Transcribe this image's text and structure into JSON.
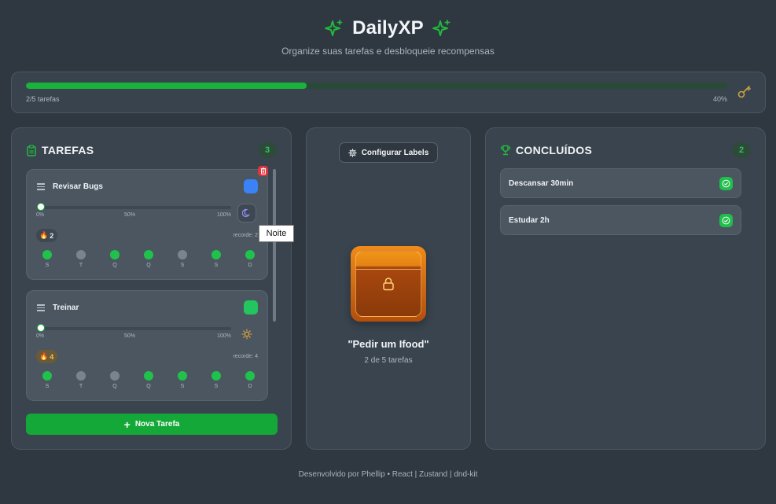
{
  "header": {
    "title": "DailyXP",
    "subtitle": "Organize suas tarefas e desbloqueie recompensas",
    "accent": "#22b83f"
  },
  "progress": {
    "label": "2/5 tarefas",
    "percent_label": "40%",
    "value": 0.4,
    "icon": "key-icon"
  },
  "tasks_column": {
    "title": "TAREFAS",
    "count": "3",
    "new_task_label": "Nova Tarefa",
    "tooltip": "Noite",
    "items": [
      {
        "name": "Revisar Bugs",
        "color": "#3b82f6",
        "slider_value": 0,
        "ticks": [
          "0%",
          "50%",
          "100%"
        ],
        "time_icon": "moon-icon",
        "streak": "2",
        "record": "recorde: 2",
        "days": [
          {
            "label": "S",
            "done": true
          },
          {
            "label": "T",
            "done": false
          },
          {
            "label": "Q",
            "done": true
          },
          {
            "label": "Q",
            "done": true
          },
          {
            "label": "S",
            "done": false
          },
          {
            "label": "S",
            "done": true
          },
          {
            "label": "D",
            "done": true
          }
        ]
      },
      {
        "name": "Treinar",
        "color": "#22c55e",
        "slider_value": 0,
        "ticks": [
          "0%",
          "50%",
          "100%"
        ],
        "time_icon": "sun-icon",
        "streak": "4",
        "record": "recorde: 4",
        "days": [
          {
            "label": "S",
            "done": true
          },
          {
            "label": "T",
            "done": false
          },
          {
            "label": "Q",
            "done": false
          },
          {
            "label": "Q",
            "done": true
          },
          {
            "label": "S",
            "done": true
          },
          {
            "label": "S",
            "done": true
          },
          {
            "label": "D",
            "done": true
          }
        ]
      }
    ]
  },
  "reward_column": {
    "config_label": "Configurar Labels",
    "reward_title": "\"Pedir um Ifood\"",
    "reward_sub": "2 de 5 tarefas"
  },
  "done_column": {
    "title": "CONCLUÍDOS",
    "count": "2",
    "items": [
      {
        "name": "Descansar 30min"
      },
      {
        "name": "Estudar 2h"
      }
    ]
  },
  "footer": "Desenvolvido por Phellip • React | Zustand | dnd-kit"
}
